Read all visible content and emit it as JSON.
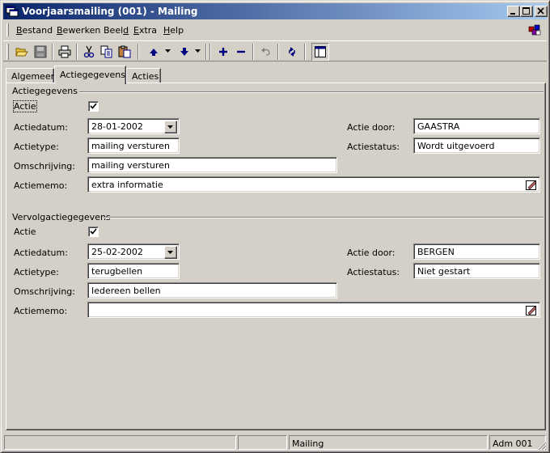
{
  "window": {
    "title": "Voorjaarsmailing (001) - Mailing",
    "icon": "window-app-icon"
  },
  "menubar": {
    "items": [
      {
        "pre": "",
        "accel": "B",
        "post": "estand"
      },
      {
        "pre": "",
        "accel": "B",
        "post": "ewerken"
      },
      {
        "pre": "Beel",
        "accel": "d",
        "post": ""
      },
      {
        "pre": "",
        "accel": "E",
        "post": "xtra"
      },
      {
        "pre": "",
        "accel": "H",
        "post": "elp"
      }
    ]
  },
  "toolbar": {
    "icons": [
      "open-folder-icon",
      "save-icon",
      "print-icon",
      "cut-icon",
      "copy-icon",
      "paste-icon",
      "previous-icon",
      "next-icon",
      "add-icon",
      "remove-icon",
      "undo-icon",
      "refresh-icon",
      "layout-icon"
    ]
  },
  "tabs": [
    "Algemeen",
    "Actiegegevens",
    "Acties"
  ],
  "active_tab": "Actiegegevens",
  "actie": {
    "group_label": "Actiegegevens",
    "checkbox_label": "Actie",
    "checked": true,
    "datum_label": "Actiedatum:",
    "datum": "28-01-2002",
    "type_label": "Actietype:",
    "type": "mailing versturen",
    "omschrijving_label": "Omschrijving:",
    "omschrijving": "mailing versturen",
    "memo_label": "Actiememo:",
    "memo": "extra informatie",
    "door_label": "Actie door:",
    "door": "GAASTRA",
    "status_label": "Actiestatus:",
    "status": "Wordt uitgevoerd"
  },
  "vervolg": {
    "group_label": "Vervolgactiegegevens",
    "checkbox_label": "Actie",
    "checked": true,
    "datum_label": "Actiedatum:",
    "datum": "25-02-2002",
    "type_label": "Actietype:",
    "type": "terugbellen",
    "omschrijving_label": "Omschrijving:",
    "omschrijving": "Iedereen bellen",
    "memo_label": "Actiememo:",
    "memo": "",
    "door_label": "Actie door:",
    "door": "BERGEN",
    "status_label": "Actiestatus:",
    "status": "Niet gestart"
  },
  "statusbar": {
    "panels": [
      "",
      "",
      "Mailing",
      "Adm 001"
    ]
  },
  "colors": {
    "face": "#d4d0c8",
    "titlebar_start": "#0a246a",
    "titlebar_end": "#a6caf0",
    "icon_blue": "#000080"
  }
}
